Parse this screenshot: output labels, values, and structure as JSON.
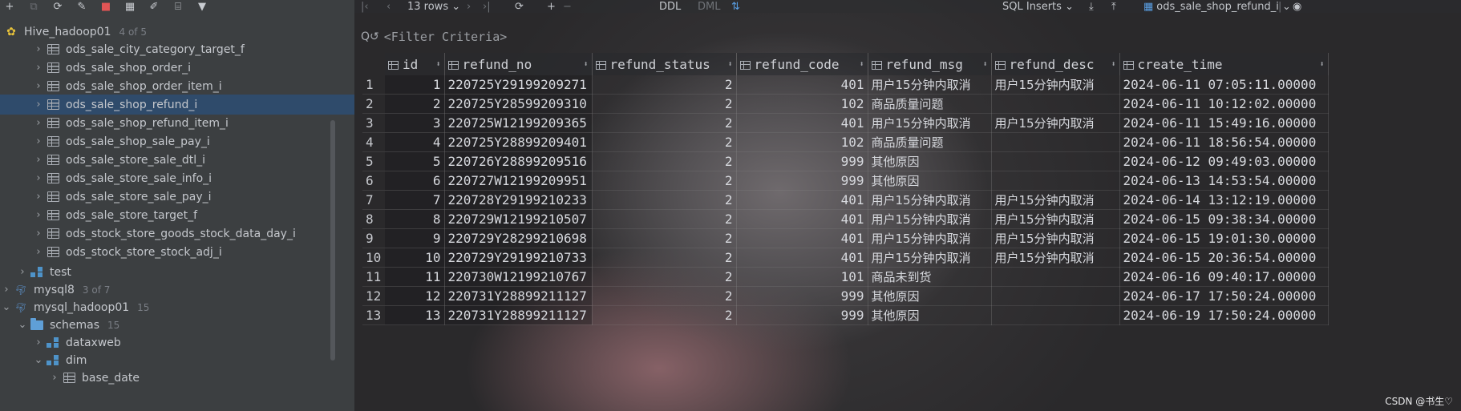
{
  "left_toolbar": {
    "icons": [
      "add-icon",
      "copy-icon",
      "refresh-icon",
      "edit-sql-icon",
      "stop-icon",
      "table-icon",
      "edit-icon",
      "sql-console-icon",
      "filter-icon"
    ]
  },
  "tree": {
    "root": {
      "label": "Hive_hadoop01",
      "count": "4 of 5"
    },
    "tables": [
      "ods_sale_city_category_target_f",
      "ods_sale_shop_order_i",
      "ods_sale_shop_order_item_i",
      "ods_sale_shop_refund_i",
      "ods_sale_shop_refund_item_i",
      "ods_sale_shop_sale_pay_i",
      "ods_sale_store_sale_dtl_i",
      "ods_sale_store_sale_info_i",
      "ods_sale_store_sale_pay_i",
      "ods_sale_store_target_f",
      "ods_stock_store_goods_stock_data_day_i",
      "ods_stock_store_stock_adj_i"
    ],
    "selected": "ods_sale_shop_refund_i",
    "test": "test",
    "mysql8": {
      "label": "mysql8",
      "count": "3 of 7"
    },
    "mysql_hadoop01": {
      "label": "mysql_hadoop01",
      "count": "15"
    },
    "schemas": {
      "label": "schemas",
      "count": "15"
    },
    "dataxweb": "dataxweb",
    "dim": "dim",
    "base_date": "base_date"
  },
  "grid_toolbar": {
    "rows": "13 rows",
    "ddl": "DDL",
    "dml": "DML",
    "export_format": "SQL Inserts",
    "table_name": "ods_sale_shop_refund_i"
  },
  "filter": {
    "placeholder": "<Filter Criteria>"
  },
  "columns": [
    "id",
    "refund_no",
    "refund_status",
    "refund_code",
    "refund_msg",
    "refund_desc",
    "create_time"
  ],
  "rows": [
    [
      "1",
      "1",
      "220725Y29199209271",
      "2",
      "401",
      "用户15分钟内取消",
      "用户15分钟内取消",
      "2024-06-11 07:05:11.00000"
    ],
    [
      "2",
      "2",
      "220725Y28599209310",
      "2",
      "102",
      "商品质量问题",
      "",
      "2024-06-11 10:12:02.00000"
    ],
    [
      "3",
      "3",
      "220725W12199209365",
      "2",
      "401",
      "用户15分钟内取消",
      "用户15分钟内取消",
      "2024-06-11 15:49:16.00000"
    ],
    [
      "4",
      "4",
      "220725Y28899209401",
      "2",
      "102",
      "商品质量问题",
      "",
      "2024-06-11 18:56:54.00000"
    ],
    [
      "5",
      "5",
      "220726Y28899209516",
      "2",
      "999",
      "其他原因",
      "",
      "2024-06-12 09:49:03.00000"
    ],
    [
      "6",
      "6",
      "220727W12199209951",
      "2",
      "999",
      "其他原因",
      "",
      "2024-06-13 14:53:54.00000"
    ],
    [
      "7",
      "7",
      "220728Y29199210233",
      "2",
      "401",
      "用户15分钟内取消",
      "用户15分钟内取消",
      "2024-06-14 13:12:19.00000"
    ],
    [
      "8",
      "8",
      "220729W12199210507",
      "2",
      "401",
      "用户15分钟内取消",
      "用户15分钟内取消",
      "2024-06-15 09:38:34.00000"
    ],
    [
      "9",
      "9",
      "220729Y28299210698",
      "2",
      "401",
      "用户15分钟内取消",
      "用户15分钟内取消",
      "2024-06-15 19:01:30.00000"
    ],
    [
      "10",
      "10",
      "220729Y29199210733",
      "2",
      "401",
      "用户15分钟内取消",
      "用户15分钟内取消",
      "2024-06-15 20:36:54.00000"
    ],
    [
      "11",
      "11",
      "220730W12199210767",
      "2",
      "101",
      "商品未到货",
      "",
      "2024-06-16 09:40:17.00000"
    ],
    [
      "12",
      "12",
      "220731Y28899211127",
      "2",
      "999",
      "其他原因",
      "",
      "2024-06-17 17:50:24.00000"
    ],
    [
      "13",
      "13",
      "220731Y28899211127",
      "2",
      "999",
      "其他原因",
      "",
      "2024-06-19 17:50:24.00000"
    ]
  ],
  "watermark": "CSDN @书生♡"
}
